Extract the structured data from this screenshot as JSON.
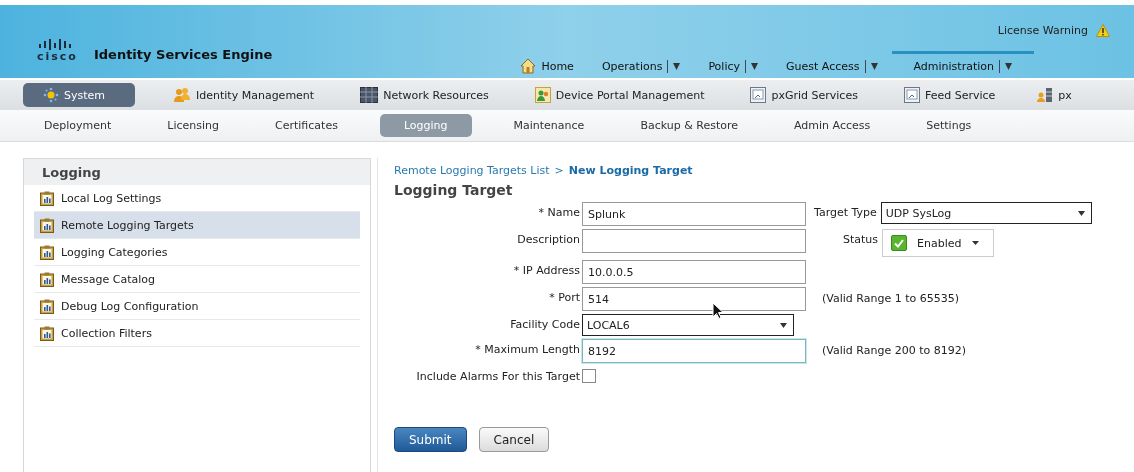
{
  "header": {
    "logo": "cisco",
    "title": "Identity Services Engine",
    "license_warning": "License Warning",
    "main_nav": [
      {
        "label": "Home",
        "kind": "home",
        "selected": false
      },
      {
        "label": "Operations",
        "kind": "menu",
        "selected": false
      },
      {
        "label": "Policy",
        "kind": "menu",
        "selected": false
      },
      {
        "label": "Guest Access",
        "kind": "menu",
        "selected": false
      },
      {
        "label": "Administration",
        "kind": "menu",
        "selected": true
      }
    ]
  },
  "section_tabs": [
    {
      "label": "System",
      "kind": "system",
      "selected": true
    },
    {
      "label": "Identity Management",
      "kind": "people",
      "selected": false
    },
    {
      "label": "Network Resources",
      "kind": "grid",
      "selected": false
    },
    {
      "label": "Device Portal Management",
      "kind": "portal",
      "selected": false
    },
    {
      "label": "pxGrid Services",
      "kind": "window",
      "selected": false
    },
    {
      "label": "Feed Service",
      "kind": "window",
      "selected": false
    },
    {
      "label": "px",
      "kind": "server",
      "selected": false
    }
  ],
  "sub_tabs": [
    {
      "label": "Deployment",
      "selected": false
    },
    {
      "label": "Licensing",
      "selected": false
    },
    {
      "label": "Certificates",
      "selected": false
    },
    {
      "label": "Logging",
      "selected": true
    },
    {
      "label": "Maintenance",
      "selected": false
    },
    {
      "label": "Backup & Restore",
      "selected": false
    },
    {
      "label": "Admin Access",
      "selected": false
    },
    {
      "label": "Settings",
      "selected": false
    }
  ],
  "sidebar": {
    "title": "Logging",
    "items": [
      {
        "label": "Local Log Settings",
        "selected": false
      },
      {
        "label": "Remote Logging Targets",
        "selected": true
      },
      {
        "label": "Logging Categories",
        "selected": false
      },
      {
        "label": "Message Catalog",
        "selected": false
      },
      {
        "label": "Debug Log Configuration",
        "selected": false
      },
      {
        "label": "Collection Filters",
        "selected": false
      }
    ]
  },
  "breadcrumb": {
    "link": "Remote Logging Targets List",
    "separator": ">",
    "current": "New Logging Target"
  },
  "form": {
    "title": "Logging Target",
    "rows": [
      {
        "label": "* Name",
        "kind": "text",
        "value": "Splunk",
        "focused": false,
        "aside": {
          "kind": "select",
          "label": "Target Type",
          "value": "UDP SysLog"
        }
      },
      {
        "label": "Description",
        "kind": "text",
        "value": "",
        "focused": false,
        "aside": {
          "kind": "status",
          "label": "Status",
          "value": "Enabled",
          "checked": true
        }
      },
      {
        "label": "* IP Address",
        "kind": "text",
        "value": "10.0.0.5",
        "focused": false
      },
      {
        "label": "* Port",
        "kind": "text",
        "value": "514",
        "focused": false,
        "aside": {
          "kind": "note",
          "text": "(Valid Range 1 to 65535)"
        }
      },
      {
        "label": "Facility Code",
        "kind": "select",
        "value": "LOCAL6"
      },
      {
        "label": "* Maximum Length",
        "kind": "text",
        "value": "8192",
        "focused": true,
        "aside": {
          "kind": "note",
          "text": "(Valid Range 200 to 8192)"
        }
      },
      {
        "label": "Include Alarms For this Target",
        "kind": "checkbox",
        "checked": false
      }
    ],
    "buttons": [
      {
        "label": "Submit",
        "kind": "primary"
      },
      {
        "label": "Cancel",
        "kind": "secondary"
      }
    ]
  }
}
